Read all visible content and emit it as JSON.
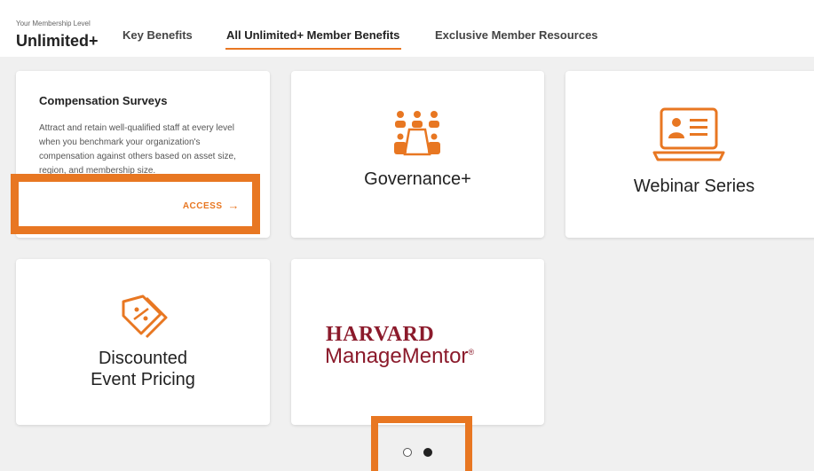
{
  "membership": {
    "caption": "Your Membership Level",
    "level": "Unlimited+"
  },
  "tabs": [
    {
      "label": "Key Benefits",
      "active": false
    },
    {
      "label": "All Unlimited+ Member Benefits",
      "active": true
    },
    {
      "label": "Exclusive Member Resources",
      "active": false
    }
  ],
  "cards": {
    "compensation": {
      "title": "Compensation Surveys",
      "description": "Attract and retain well-qualified staff at every level when you benchmark your organization's compensation against others based on asset size, region, and membership size.",
      "action": "ACCESS"
    },
    "governance": {
      "label": "Governance+",
      "icon": "governance-meeting-icon"
    },
    "webinar": {
      "label": "Webinar Series",
      "icon": "webinar-laptop-icon"
    },
    "discounted": {
      "label_line1": "Discounted",
      "label_line2": "Event Pricing",
      "icon": "discount-tag-icon"
    },
    "harvard": {
      "line1": "HARVARD",
      "line2": "ManageMentor",
      "trademark": "®"
    }
  },
  "pagination": {
    "total": 2,
    "current": 2
  },
  "colors": {
    "accent": "#e87722",
    "harvard": "#8b1a2b",
    "background": "#f0f0f0"
  }
}
